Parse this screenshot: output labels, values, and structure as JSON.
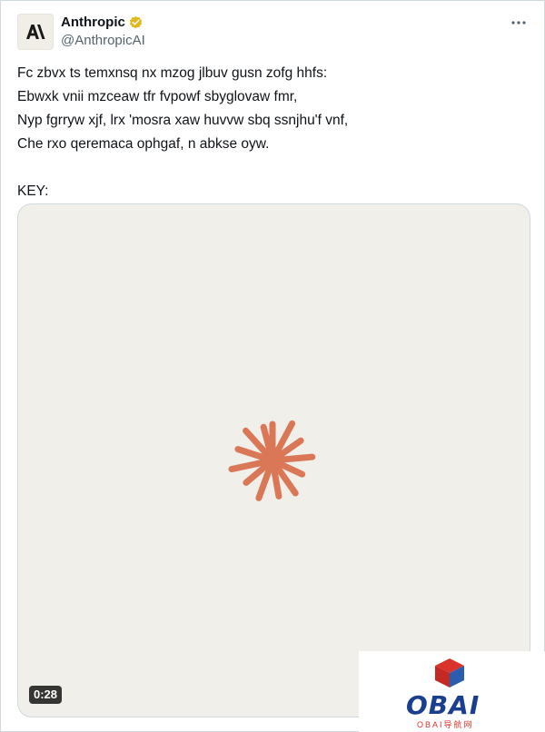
{
  "author": {
    "display_name": "Anthropic",
    "handle": "@AnthropicAI",
    "avatar_icon": "anthropic-logo-icon",
    "verified_icon": "verified-badge-icon",
    "verified_color": "#e2b719"
  },
  "menu": {
    "icon": "more-horizontal-icon"
  },
  "tweet": {
    "lines": [
      "Fc zbvx ts temxnsq nx mzog jlbuv gusn zofg hhfs:",
      "Ebwxk vnii mzceaw tfr fvpowf sbyglovaw fmr,",
      "Nyp fgrryw xjf, lrx 'mosra xaw huvvw sbq ssnjhu'f vnf,",
      "Che rxo qeremaca ophgaf, n abkse oyw."
    ],
    "key_label": "KEY:"
  },
  "media": {
    "duration": "0:28",
    "icon": "claude-spark-icon",
    "accent_color": "#d97757",
    "background_color": "#f0efea"
  },
  "watermark": {
    "brand": "OBAI",
    "subtitle": "OBAI导航网",
    "icon": "cube-logo-icon"
  }
}
